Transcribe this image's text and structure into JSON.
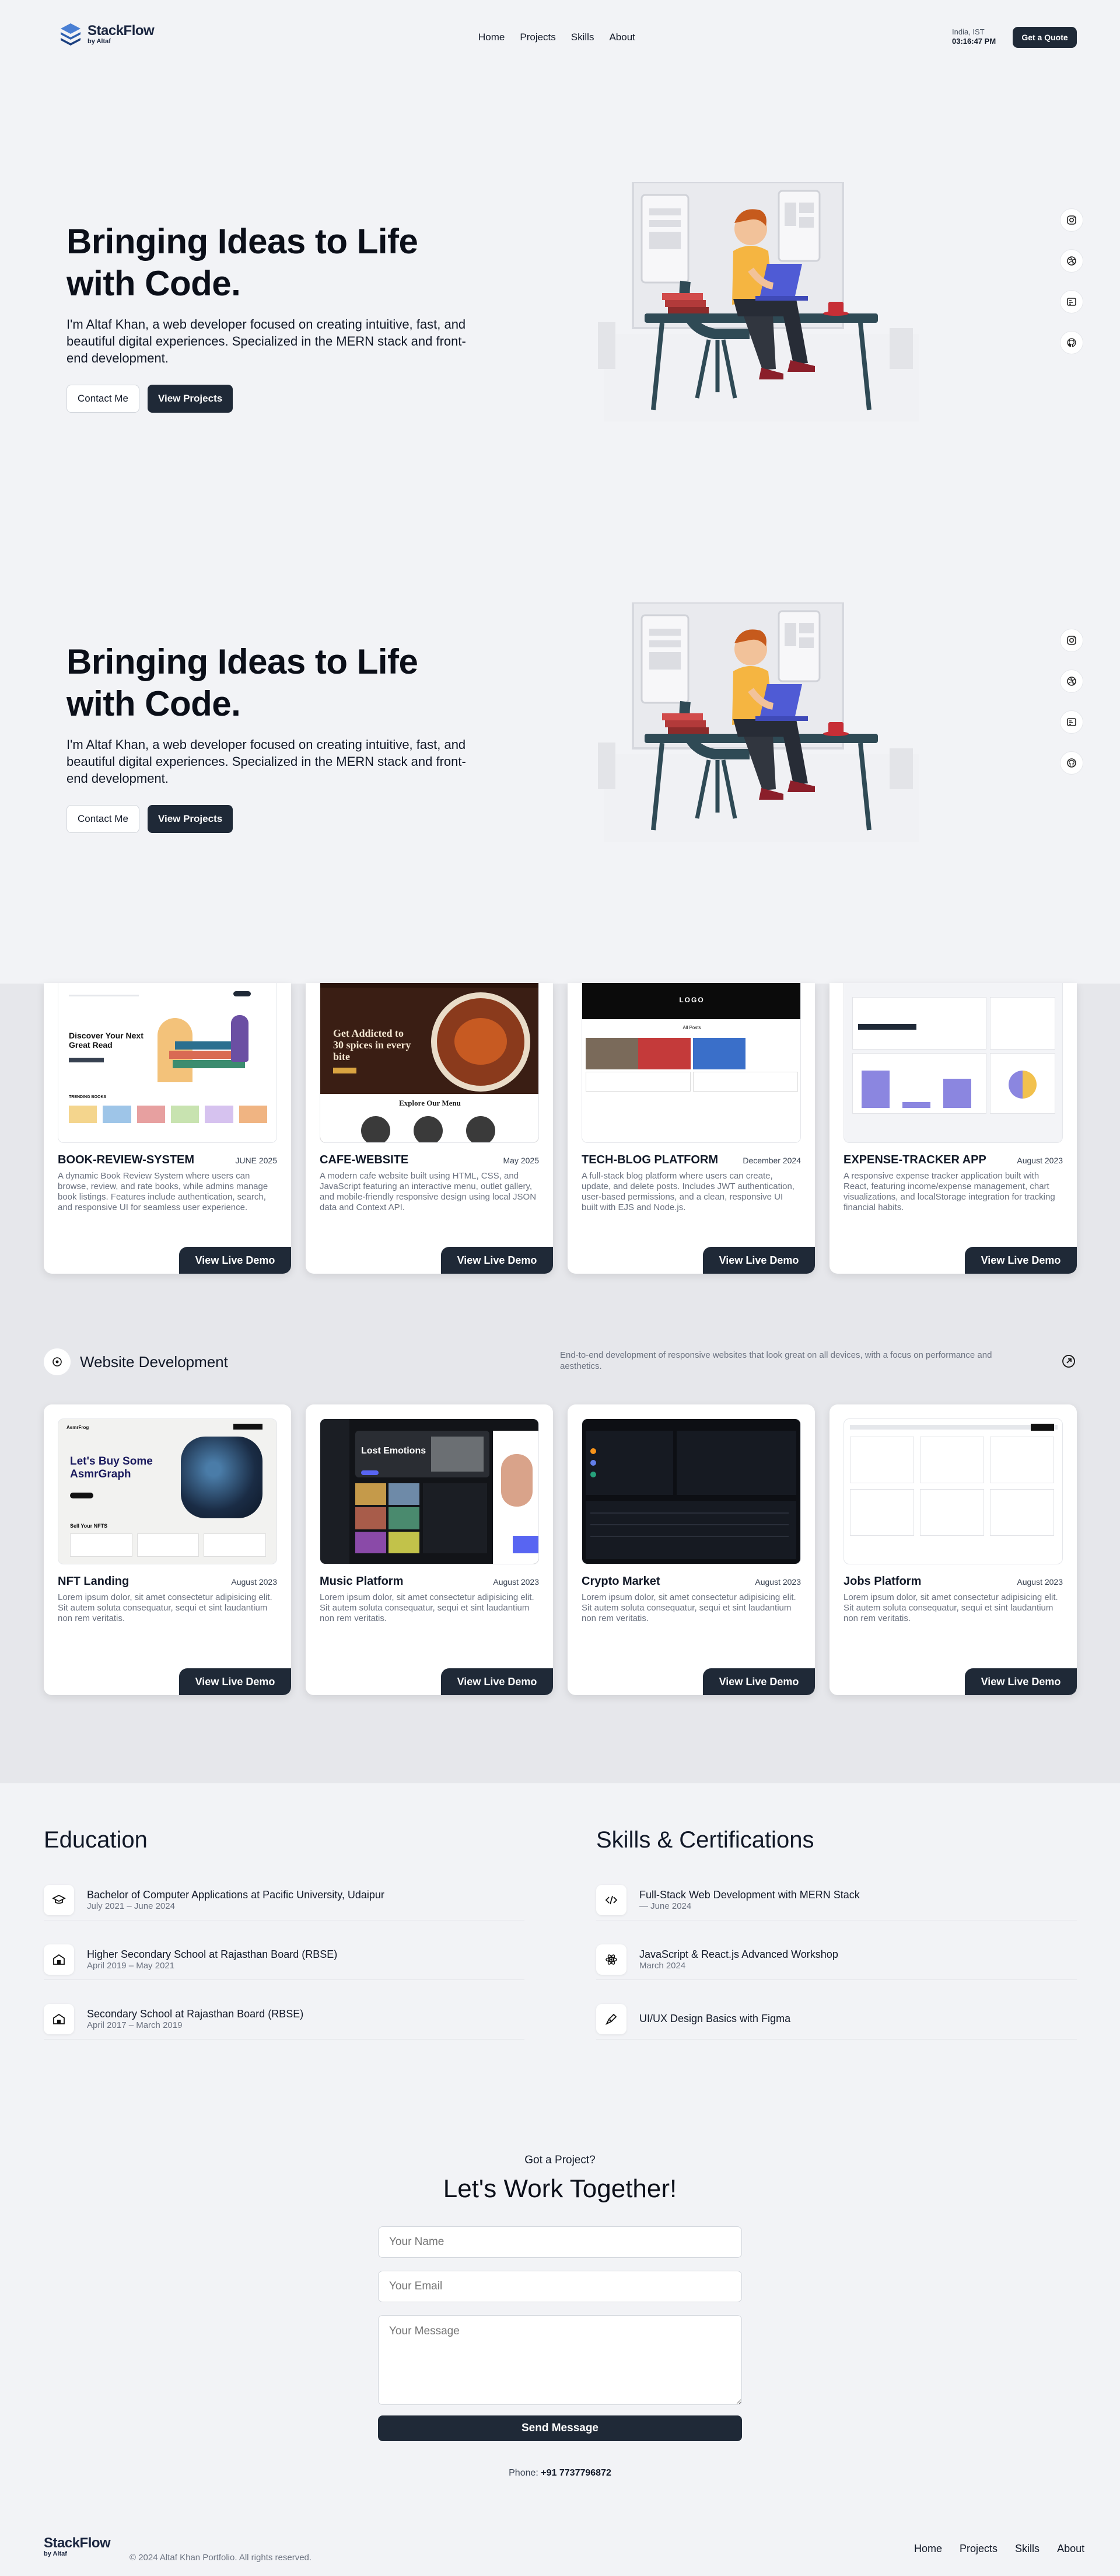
{
  "nav": {
    "brand": "StackFlow",
    "by": "by Altaf",
    "links": [
      "Home",
      "Projects",
      "Skills",
      "About"
    ],
    "location": "India, IST",
    "time": "03:16:47 PM",
    "cta": "Get a Quote"
  },
  "hero": {
    "title": "Bringing Ideas to Life with Code.",
    "intro": "I'm Altaf Khan, a web developer focused on creating intuitive, fast, and beautiful digital experiences. Specialized in the MERN stack and front-end development.",
    "contact_btn": "Contact Me",
    "projects_btn": "View Projects",
    "socials": [
      "instagram-icon",
      "dribbble-icon",
      "behance-icon",
      "github-icon"
    ]
  },
  "projects_top": [
    {
      "title": "BOOK-REVIEW-SYSTEM",
      "date": "JUNE 2025",
      "desc": "A dynamic Book Review System where users can browse, review, and rate books, while admins manage book listings. Features include authentication, search, and responsive UI for seamless user experience.",
      "cta": "View Live Demo"
    },
    {
      "title": "CAFE-WEBSITE",
      "date": "May 2025",
      "desc": "A modern cafe website built using HTML, CSS, and JavaScript featuring an interactive menu, outlet gallery, and mobile-friendly responsive design using local JSON data and Context API.",
      "cta": "View Live Demo"
    },
    {
      "title": "TECH-BLOG PLATFORM",
      "date": "December 2024",
      "desc": "A full-stack blog platform where users can create, update, and delete posts. Includes JWT authentication, user-based permissions, and a clean, responsive UI built with EJS and Node.js.",
      "cta": "View Live Demo"
    },
    {
      "title": "EXPENSE-TRACKER APP",
      "date": "August 2023",
      "desc": "A responsive expense tracker application built with React, featuring income/expense management, chart visualizations, and localStorage integration for tracking financial habits.",
      "cta": "View Live Demo"
    }
  ],
  "web_section": {
    "title": "Website Development",
    "desc": "End-to-end development of responsive websites that look great on all devices, with a focus on performance and aesthetics."
  },
  "projects_web": [
    {
      "title": "NFT Landing",
      "date": "August 2023",
      "desc": "Lorem ipsum dolor, sit amet consectetur adipisicing elit. Sit autem soluta consequatur, sequi et sint laudantium non rem veritatis.",
      "cta": "View Live Demo"
    },
    {
      "title": "Music Platform",
      "date": "August 2023",
      "desc": "Lorem ipsum dolor, sit amet consectetur adipisicing elit. Sit autem soluta consequatur, sequi et sint laudantium non rem veritatis.",
      "cta": "View Live Demo"
    },
    {
      "title": "Crypto Market",
      "date": "August 2023",
      "desc": "Lorem ipsum dolor, sit amet consectetur adipisicing elit. Sit autem soluta consequatur, sequi et sint laudantium non rem veritatis.",
      "cta": "View Live Demo"
    },
    {
      "title": "Jobs Platform",
      "date": "August 2023",
      "desc": "Lorem ipsum dolor, sit amet consectetur adipisicing elit. Sit autem soluta consequatur, sequi et sint laudantium non rem veritatis.",
      "cta": "View Live Demo"
    }
  ],
  "thumbs": {
    "book": {
      "headline": "Discover Your Next Great Read",
      "sub": "TRENDING BOOKS"
    },
    "cafe": {
      "headline": "Get Addicted to 30 spices in every bite",
      "sub": "Explore Our Menu"
    },
    "blog": {
      "logo": "LOGO",
      "sub": "All Posts"
    },
    "nft": {
      "brand": "AsmrFrog",
      "headline": "Let's Buy Some AsmrGraph",
      "sub": "Sell Your NFTS"
    },
    "music": {
      "headline": "Lost Emotions"
    }
  },
  "education": {
    "title": "Education",
    "items": [
      {
        "title": "Bachelor of Computer Applications at Pacific University, Udaipur",
        "date": "July 2021 – June 2024"
      },
      {
        "title": "Higher Secondary School at Rajasthan Board (RBSE)",
        "date": "April 2019 – May 2021"
      },
      {
        "title": "Secondary School at Rajasthan Board (RBSE)",
        "date": "April 2017 – March 2019"
      }
    ]
  },
  "skills": {
    "title": "Skills & Certifications",
    "items": [
      {
        "title": "Full-Stack Web Development with MERN Stack",
        "date": "— June 2024"
      },
      {
        "title": "JavaScript & React.js Advanced Workshop",
        "date": "March 2024"
      },
      {
        "title": "UI/UX Design Basics with Figma",
        "date": ""
      }
    ]
  },
  "contact": {
    "eyebrow": "Got a Project?",
    "title": "Let's Work Together!",
    "name_ph": "Your Name",
    "email_ph": "Your Email",
    "message_ph": "Your Message",
    "send": "Send Message",
    "phone_label": "Phone:",
    "phone": "+91 7737796872"
  },
  "footer": {
    "brand": "StackFlow",
    "by": "by Altaf",
    "copyright": "© 2024 Altaf Khan Portfolio. All rights reserved.",
    "links": [
      "Home",
      "Projects",
      "Skills",
      "About"
    ]
  },
  "colors": {
    "accent": "#1f2937",
    "band": "#e6e7eb",
    "bg": "#f2f3f6",
    "shirt": "#f5b541",
    "laptop": "#4f5bd5"
  }
}
